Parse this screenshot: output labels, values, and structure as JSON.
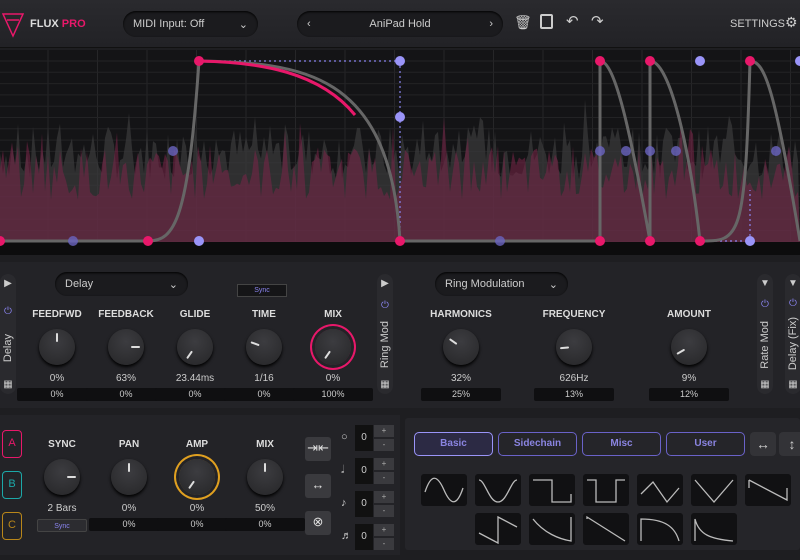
{
  "header": {
    "logo": "FLUX",
    "logo_accent": "PRO",
    "midi": "MIDI Input: Off",
    "preset": "AniPad Hold",
    "settings": "SETTINGS"
  },
  "colors": {
    "accent": "#e8186a",
    "purple": "#8a84f0",
    "amber": "#e0a020",
    "teal": "#1ca8a8"
  },
  "fx1": {
    "side_label": "Delay",
    "type": "Delay",
    "sync": "Sync",
    "knobs": [
      {
        "label": "FEEDFWD",
        "value": "0%",
        "mod": "0%"
      },
      {
        "label": "FEEDBACK",
        "value": "63%",
        "mod": "0%"
      },
      {
        "label": "GLIDE",
        "value": "23.44ms",
        "mod": "0%"
      },
      {
        "label": "TIME",
        "value": "1/16",
        "mod": "0%"
      },
      {
        "label": "MIX",
        "value": "0%",
        "mod": "100%"
      }
    ]
  },
  "fx2": {
    "side_label": "Ring Mod",
    "type": "Ring Modulation",
    "knobs": [
      {
        "label": "HARMONICS",
        "value": "32%",
        "mod": "25%"
      },
      {
        "label": "FREQUENCY",
        "value": "626Hz",
        "mod": "13%"
      },
      {
        "label": "AMOUNT",
        "value": "9%",
        "mod": "12%"
      }
    ]
  },
  "fx3": {
    "side_label": "Rate Mod"
  },
  "fx4": {
    "side_label": "Delay (Fix)"
  },
  "lfo": {
    "slots": [
      "A",
      "B",
      "C"
    ],
    "sync_btn": "Sync",
    "knobs": [
      {
        "label": "SYNC",
        "value": "2 Bars"
      },
      {
        "label": "PAN",
        "value": "0%",
        "mod": "0%"
      },
      {
        "label": "AMP",
        "value": "0%",
        "mod": "0%"
      },
      {
        "label": "MIX",
        "value": "50%",
        "mod": "0%"
      }
    ],
    "steppers": [
      {
        "note": "whole",
        "value": "0"
      },
      {
        "note": "half",
        "value": "0"
      },
      {
        "note": "eighth",
        "value": "0"
      },
      {
        "note": "sixteenth",
        "value": "0"
      }
    ],
    "plus": "+",
    "minus": "-"
  },
  "shapes": {
    "tabs": [
      "Basic",
      "Sidechain",
      "Misc",
      "User"
    ],
    "active_tab": "Basic",
    "items": [
      "sine",
      "inverted-sine",
      "square",
      "inverted-square",
      "triangle",
      "v-shape",
      "saw-down",
      "saw-up",
      "exp-down",
      "ramp-down",
      "curve-down",
      "decay"
    ]
  }
}
